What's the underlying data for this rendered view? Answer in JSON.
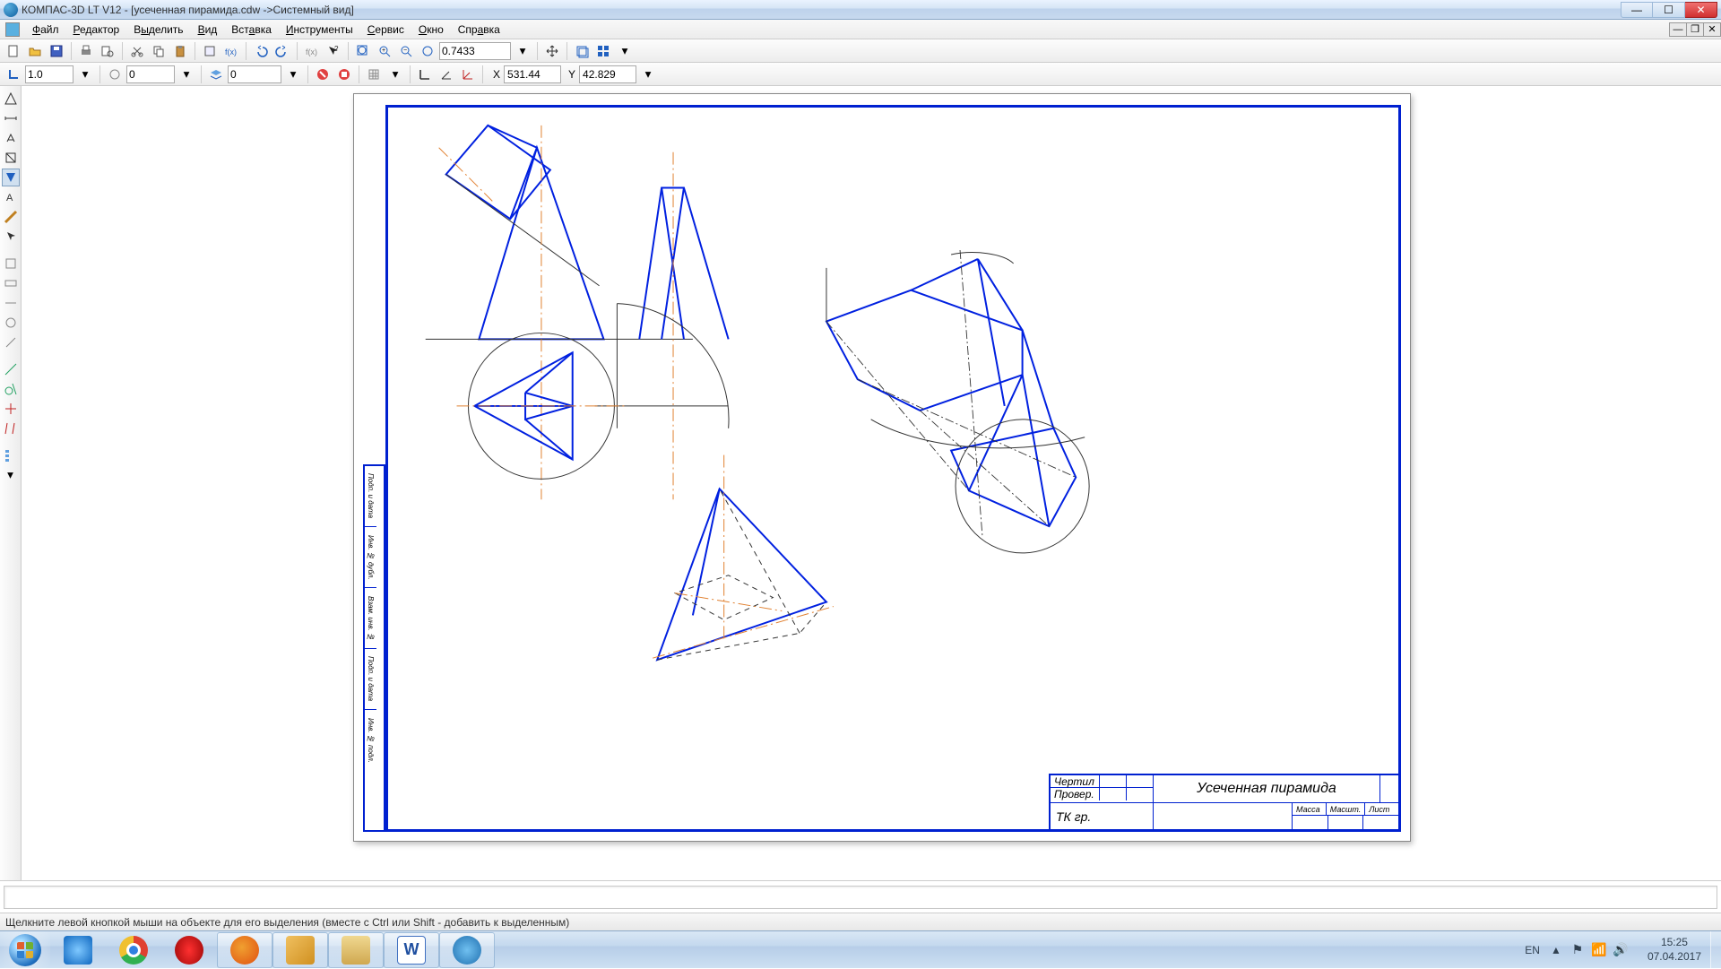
{
  "titlebar": {
    "text": "КОМПАС-3D LT V12 - [усеченная пирамида.cdw ->Системный вид]"
  },
  "menu": {
    "file": "Файл",
    "editor": "Редактор",
    "select": "Выделить",
    "view": "Вид",
    "insert": "Вставка",
    "tools": "Инструменты",
    "service": "Сервис",
    "window": "Окно",
    "help": "Справка"
  },
  "toolbar1": {
    "zoom_value": "0.7433"
  },
  "toolbar2": {
    "line_weight": "1.0",
    "style_a": "0",
    "style_b": "0",
    "coord_x": "531.44",
    "coord_y": "42.829"
  },
  "drawing": {
    "title": "Усеченная пирамида",
    "author_label": "Чертил",
    "checked_label": "Провер.",
    "org": "ТК гр.",
    "mass_label": "Масса",
    "scale_label": "Масшт.",
    "sheet_label": "Лист",
    "side_labels": [
      "Подп. и дата",
      "Инв. № дубл.",
      "Взам. инв. №",
      "Подп. и дата",
      "Инв. № подл."
    ]
  },
  "status": {
    "text": "Щелкните левой кнопкой мыши на объекте для его выделения (вместе с Ctrl или Shift - добавить к выделенным)"
  },
  "taskbar": {
    "lang": "EN",
    "time": "15:25",
    "date": "07.04.2017"
  }
}
